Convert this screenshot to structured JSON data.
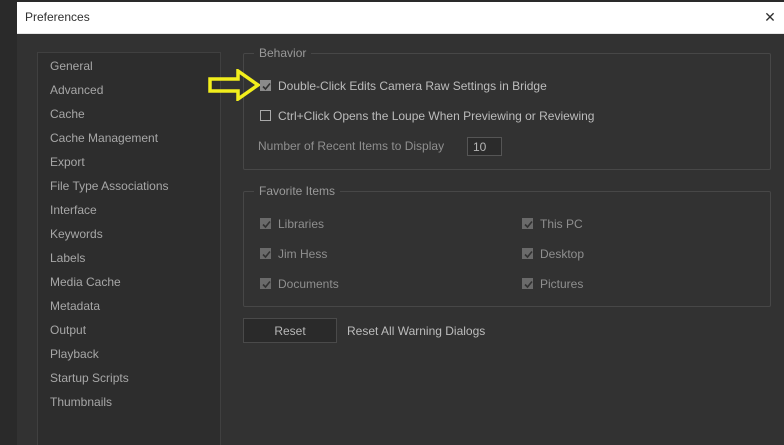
{
  "window": {
    "title": "Preferences",
    "close_glyph": "✕"
  },
  "sidebar": {
    "items": [
      {
        "label": "General"
      },
      {
        "label": "Advanced"
      },
      {
        "label": "Cache"
      },
      {
        "label": "Cache Management"
      },
      {
        "label": "Export"
      },
      {
        "label": "File Type Associations"
      },
      {
        "label": "Interface"
      },
      {
        "label": "Keywords"
      },
      {
        "label": "Labels"
      },
      {
        "label": "Media Cache"
      },
      {
        "label": "Metadata"
      },
      {
        "label": "Output"
      },
      {
        "label": "Playback"
      },
      {
        "label": "Startup Scripts"
      },
      {
        "label": "Thumbnails"
      }
    ]
  },
  "behavior": {
    "legend": "Behavior",
    "double_click_label": "Double-Click Edits Camera Raw Settings in Bridge",
    "double_click_checked": true,
    "ctrl_click_label": "Ctrl+Click Opens the Loupe When Previewing or Reviewing",
    "ctrl_click_checked": false,
    "recent_items_label": "Number of Recent Items to Display",
    "recent_items_value": "10"
  },
  "favorites": {
    "legend": "Favorite Items",
    "items": [
      {
        "label": "Libraries",
        "checked": true
      },
      {
        "label": "Jim Hess",
        "checked": true
      },
      {
        "label": "Documents",
        "checked": true
      },
      {
        "label": "This PC",
        "checked": true
      },
      {
        "label": "Desktop",
        "checked": true
      },
      {
        "label": "Pictures",
        "checked": true
      }
    ]
  },
  "reset": {
    "button_label": "Reset",
    "description": "Reset All Warning Dialogs"
  },
  "annotation": {
    "arrow_icon": "arrow-right-icon",
    "arrow_color": "#f2ee1c"
  }
}
